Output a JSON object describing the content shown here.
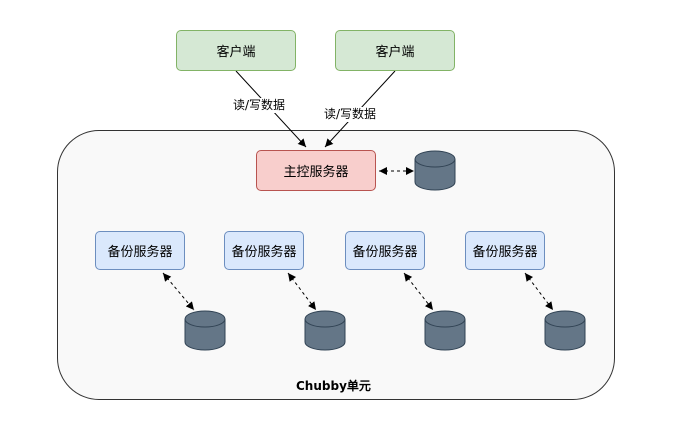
{
  "clients": [
    {
      "label": "客户端"
    },
    {
      "label": "客户端"
    }
  ],
  "edge_labels": [
    "读/写数据",
    "读/写数据"
  ],
  "master": {
    "label": "主控服务器"
  },
  "backups": [
    {
      "label": "备份服务器"
    },
    {
      "label": "备份服务器"
    },
    {
      "label": "备份服务器"
    },
    {
      "label": "备份服务器"
    }
  ],
  "unit": {
    "label": "Chubby单元"
  },
  "icons": {
    "storage": "database-cylinder-icon"
  },
  "colors": {
    "client_fill": "#d5e8d4",
    "client_stroke": "#82b366",
    "master_fill": "#f8cecc",
    "master_stroke": "#b85450",
    "backup_fill": "#dae8fc",
    "backup_stroke": "#6c8ebf",
    "db_fill": "#647687",
    "db_stroke": "#314354"
  }
}
